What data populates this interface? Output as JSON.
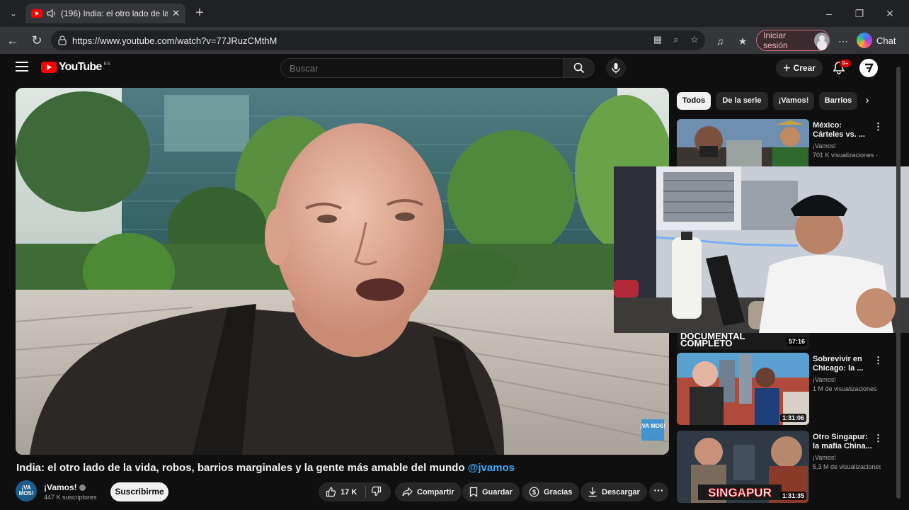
{
  "browser": {
    "tab_title": "(196) India: el otro lado de la v",
    "url": "https://www.youtube.com/watch?v=77JRuzCMthM",
    "signin_label": "Iniciar sesión",
    "chat_label": "Chat"
  },
  "youtube": {
    "logo_text": "YouTube",
    "logo_sup": "ES",
    "search_placeholder": "Buscar",
    "create_label": "Crear",
    "notifications_badge": "9+"
  },
  "video": {
    "title": "India: el otro lado de la vida, robos, barrios marginales y la gente más amable del mundo",
    "mention": "@jvamos",
    "channel_avatar_text": "¡VA MOS!",
    "channel_name": "¡Vamos!",
    "subscribers": "447 K suscriptores",
    "subscribe_label": "Suscribirme",
    "likes": "17 K",
    "share_label": "Compartir",
    "save_label": "Guardar",
    "thanks_label": "Gracias",
    "download_label": "Descargar",
    "more_label": "···"
  },
  "chips": [
    {
      "label": "Todos",
      "active": true
    },
    {
      "label": "De la serie",
      "active": false
    },
    {
      "label": "¡Vamos!",
      "active": false
    },
    {
      "label": "Barrios",
      "active": false
    }
  ],
  "recommendations": [
    {
      "title": "México: Cárteles vs. ...",
      "channel": "¡Vamos!",
      "views": "701 K visualizaciones ·",
      "duration": ""
    },
    {
      "title": "Sobrevivir en Chicago: la ...",
      "channel": "¡Vamos!",
      "views": "1 M de visualizaciones",
      "duration": "1:31:06"
    },
    {
      "title": "Otro Singapur: la mafia China...",
      "channel": "¡Vamos!",
      "views": "5,3 M de visualizaciones",
      "duration": "1:31:35"
    }
  ],
  "overlay_caption": {
    "line1": "DOCUMENTAL",
    "line2": "COMPLETO",
    "duration": "57:16"
  },
  "thumb_text": {
    "singapur": "SINGAPUR",
    "video_watermark": "¡VA MOS!"
  },
  "colors": {
    "yt_red": "#ff0000",
    "link_blue": "#3ea6ff",
    "background": "#0f0f0f"
  }
}
